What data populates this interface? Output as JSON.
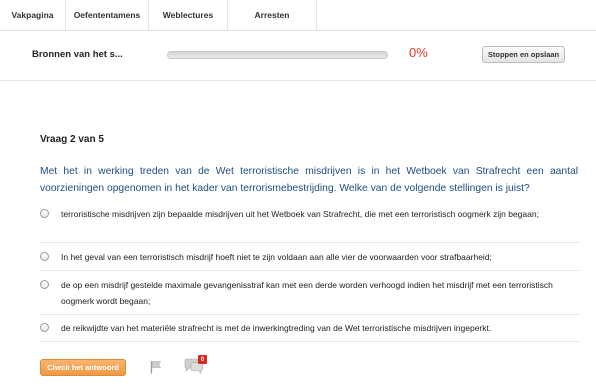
{
  "nav": {
    "tabs": [
      {
        "label": "Vakpagina"
      },
      {
        "label": "Oefententamens"
      },
      {
        "label": "Weblectures"
      },
      {
        "label": "Arresten"
      }
    ]
  },
  "header": {
    "title": "Bronnen van het s...",
    "progress_percent": 0,
    "progress_label": "0%",
    "stop_button_label": "Stoppen en opslaan"
  },
  "question": {
    "counter": "Vraag 2 van 5",
    "text": "Met het in werking treden van de Wet terroristische misdrijven is in het Wetboek van Strafrecht een aantal voorzieningen opgenomen in het kader van terrorismebestrijding. Welke van de volgende stellingen is juist?",
    "options": [
      {
        "label": "terroristische misdrijven zijn bepaalde misdrijven uit het Wetboek van Strafrecht, die met een terroristisch oogmerk zijn begaan;"
      },
      {
        "label": "In het geval van een terroristisch misdrijf hoeft niet te zijn voldaan aan alle vier de voorwaarden voor strafbaarheid;"
      },
      {
        "label": "de op een misdrijf gestelde maximale gevangenisstraf kan met een derde worden verhoogd indien het misdrijf met een terroristisch oogmerk wordt begaan;"
      },
      {
        "label": "de reikwijdte van het materiële strafrecht is met de inwerkingtreding van de Wet terroristische misdrijven ingeperkt."
      }
    ]
  },
  "footer": {
    "check_button_label": "Check het antwoord",
    "comment_count": "0"
  },
  "colors": {
    "accent_orange": "#ee9a45",
    "question_blue": "#1d4e84",
    "percent_red": "#e8372f"
  }
}
